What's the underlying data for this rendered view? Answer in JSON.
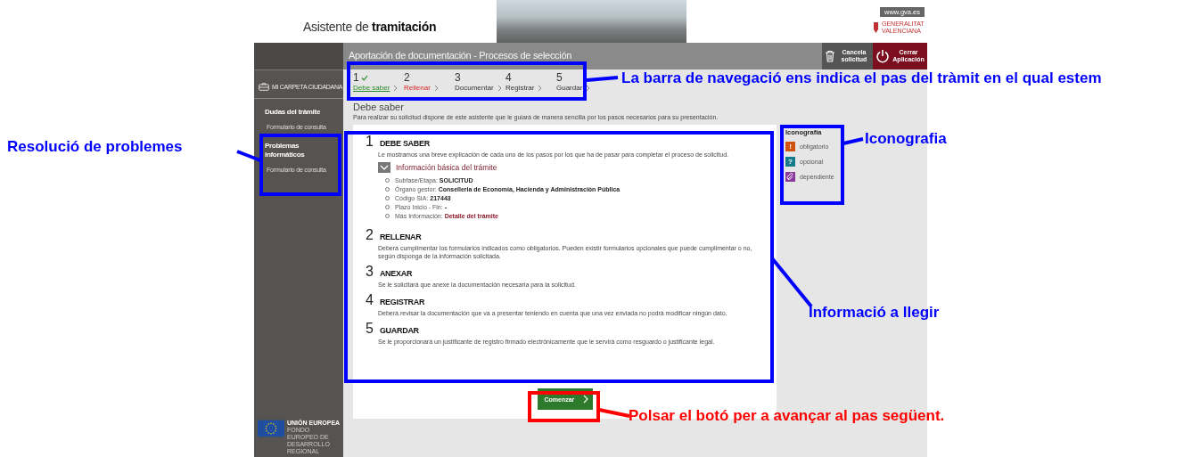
{
  "header": {
    "title_plain": "Asistente de",
    "title_bold": "tramitación",
    "site_link": "www.gva.es",
    "logo_text": "GENERALITAT VALENCIANA"
  },
  "sidebar": {
    "carpeta_button": "MI CARPETA CIUDADANA",
    "sections": [
      {
        "title": "Dudas del trámite",
        "link": "Formulario de consulta"
      },
      {
        "title": "Problemas informáticos",
        "link": "Formulario de consulta"
      }
    ],
    "eu_logo": {
      "title": "UNIÓN EUROPEA",
      "subtitle": "FONDO EUROPEO DE DESARROLLO REGIONAL"
    }
  },
  "title_bar": {
    "title": "Aportación de documentación - Procesos de selección",
    "buttons": [
      {
        "kind": "cancel",
        "label": "Cancela solicitud"
      },
      {
        "kind": "close",
        "label": "Cerrar Aplicación"
      }
    ]
  },
  "steps": [
    {
      "number": "1",
      "label": "Debe saber",
      "selected": true,
      "completed": true,
      "warning": false
    },
    {
      "number": "2",
      "label": "Rellenar",
      "selected": false,
      "completed": false,
      "warning": true
    },
    {
      "number": "3",
      "label": "Documentar",
      "selected": false,
      "completed": false,
      "warning": false
    },
    {
      "number": "4",
      "label": "Registrar",
      "selected": false,
      "completed": false,
      "warning": false
    },
    {
      "number": "5",
      "label": "Guardar",
      "selected": false,
      "completed": false,
      "warning": false
    }
  ],
  "page": {
    "heading": "Debe saber",
    "intro": "Para realizar su solicitud dispone de este asistente que le guiará de manera sencilla por los pasos necesarios para su presentación."
  },
  "sections": [
    {
      "number": "1",
      "title": "DEBE SABER",
      "text": "Le mostramos una breve explicación de cada uno de los pasos por los que ha de pasar para completar el proceso de solicitud.",
      "info": {
        "title": "Información básica del trámite",
        "expanded": true,
        "items": [
          {
            "label": "Subfase/Etapa:",
            "value": "SOLICITUD"
          },
          {
            "label": "Órgano gestor:",
            "value": "Conselleria de Economía, Hacienda y Administración Pública"
          },
          {
            "label": "Código SIA:",
            "value": "217443"
          },
          {
            "label": "Plazo Inicio - Fin:",
            "value": "-"
          },
          {
            "label": "Más Información:",
            "link": "Detalle del trámite"
          }
        ]
      }
    },
    {
      "number": "2",
      "title": "RELLENAR",
      "text": "Deberá cumplimentar los formularios indicados como obligatorios. Pueden existir formularios opcionales que puede cumplimentar o no, según disponga de la información solicitada."
    },
    {
      "number": "3",
      "title": "ANEXAR",
      "text": "Se le solicitará que anexe la documentación necesaria para la solicitud."
    },
    {
      "number": "4",
      "title": "REGISTRAR",
      "text": "Deberá revisar la documentación que va a presentar teniendo en cuenta que una vez enviada no podrá modificar ningún dato."
    },
    {
      "number": "5",
      "title": "GUARDAR",
      "text": "Se le proporcionará un justificante de registro firmado electrónicamente que le servirá como resguardo o justificante legal."
    }
  ],
  "start_button": "Comenzar",
  "legend": {
    "title": "Iconografía",
    "items": [
      {
        "kind": "glyph",
        "symbol": "!",
        "label": "obligatorio",
        "color": "#d0520e"
      },
      {
        "kind": "glyph",
        "symbol": "?",
        "label": "opcional",
        "color": "#157a8a"
      },
      {
        "kind": "chain",
        "label": "dependiente",
        "color": "#8b3a9c"
      }
    ]
  },
  "annotations": [
    {
      "text": "La barra de navegació ens indica el pas del tràmit en el qual estem",
      "color": "#0000ff"
    },
    {
      "text": "Resolució de problemes",
      "color": "#0000ff"
    },
    {
      "text": "Iconografia",
      "color": "#0000ff"
    },
    {
      "text": "Informació a llegir",
      "color": "#0000ff"
    },
    {
      "text": "Polsar el botó per a avançar al pas següent.",
      "color": "#ff0000"
    }
  ]
}
